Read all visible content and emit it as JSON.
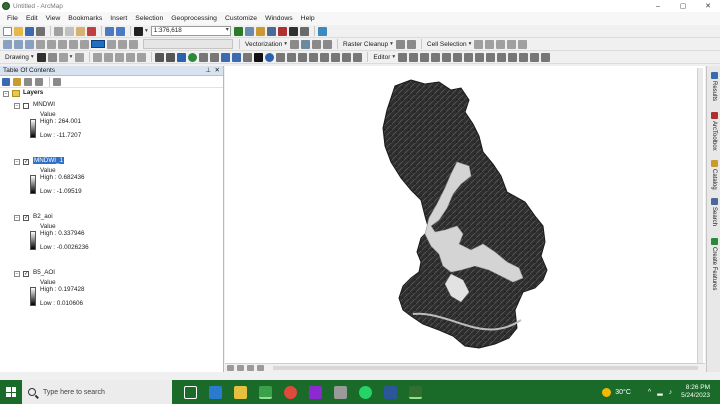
{
  "window": {
    "title": "Untitled - ArcMap",
    "controls": [
      "–",
      "▢",
      "✕"
    ]
  },
  "menu": [
    "File",
    "Edit",
    "View",
    "Bookmarks",
    "Insert",
    "Selection",
    "Geoprocessing",
    "Customize",
    "Windows",
    "Help"
  ],
  "toolbars": {
    "scale": "1:376,618",
    "vectorization": "Vectorization",
    "raster_cleanup": "Raster Cleanup",
    "cell_selection": "Cell Selection",
    "drawing": "Drawing",
    "editor": "Editor"
  },
  "toc": {
    "title": "Table Of Contents",
    "pin": "⊥",
    "close": "✕",
    "root": "Layers",
    "layers": [
      {
        "name": "MNDWI",
        "checked": false,
        "value_label": "Value",
        "high": "High : 264.001",
        "low": "Low : -11.7207"
      },
      {
        "name": "MNDWI_1",
        "checked": true,
        "value_label": "Value",
        "high": "High : 0.682436",
        "low": "Low : -1.09519"
      },
      {
        "name": "B2_aoi",
        "checked": true,
        "value_label": "Value",
        "high": "High : 0.337946",
        "low": "Low : -0.0026236"
      },
      {
        "name": "B5_AOI",
        "checked": true,
        "value_label": "Value",
        "high": "High : 0.197428",
        "low": "Low : 0.010606"
      }
    ]
  },
  "right_dock": [
    "Results",
    "ArcToolbox",
    "Catalog",
    "Search",
    "Create Features"
  ],
  "taskbar": {
    "search_placeholder": "Type here to search",
    "temperature": "30°C",
    "tray_caret": "^",
    "time": "8:26 PM",
    "date": "5/24/2023"
  },
  "colors": {
    "taskbar": "#1a6a2a",
    "toc_header": "#d9e3f0",
    "selection": "#3070c8"
  }
}
